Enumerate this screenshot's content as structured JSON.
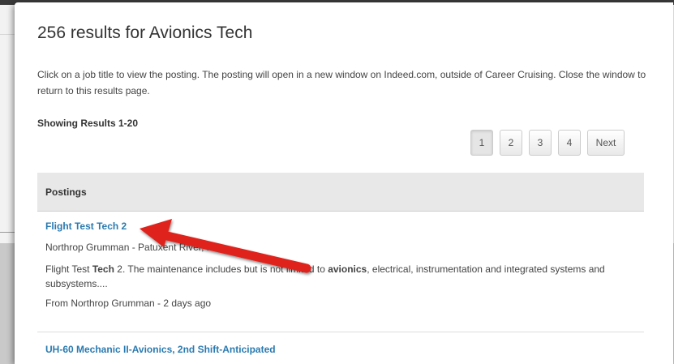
{
  "header": {
    "title": "256 results for Avionics Tech",
    "description": "Click on a job title to view the posting. The posting will open in a new window on Indeed.com, outside of Career Cruising. Close the window to return to this results page."
  },
  "results": {
    "showing": "Showing Results 1-20"
  },
  "pagination": {
    "pages": [
      "1",
      "2",
      "3",
      "4"
    ],
    "active_page": "1",
    "next_label": "Next"
  },
  "postings": {
    "header": "Postings",
    "items": [
      {
        "title": "Flight Test Tech 2",
        "company": "Northrop Grumman - Patuxent River, MD",
        "snippet_parts": [
          "Flight Test ",
          "Tech",
          " 2. The maintenance includes but is not limited to ",
          "avionics",
          ", electrical, instrumentation and integrated systems and subsystems...."
        ],
        "source": "From Northrop Grumman - 2 days ago"
      },
      {
        "title": "UH-60 Mechanic II-Avionics, 2nd Shift-Anticipated"
      }
    ]
  },
  "colors": {
    "link": "#2a7ab0",
    "arrow": "#e0201b",
    "header_bg": "#e8e8e8"
  }
}
